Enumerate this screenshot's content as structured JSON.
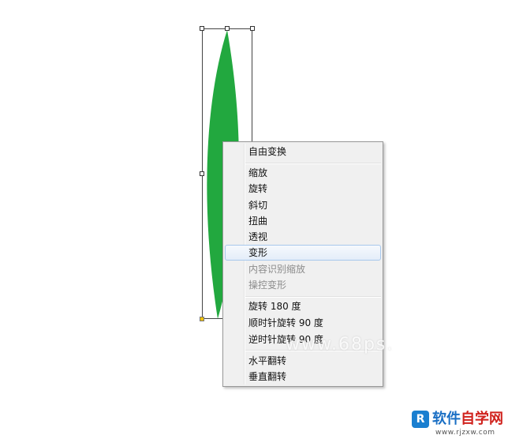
{
  "colors": {
    "leaf_fill": "#22a83f",
    "menu_background": "#f0f0f0",
    "menu_highlight_border": "#a8c8ec",
    "disabled_text": "#8c8c8c",
    "anchor_active": "#f0c000"
  },
  "context_menu": {
    "items": [
      {
        "label": "自由变换",
        "enabled": true
      },
      {
        "label": "缩放",
        "enabled": true
      },
      {
        "label": "旋转",
        "enabled": true
      },
      {
        "label": "斜切",
        "enabled": true
      },
      {
        "label": "扭曲",
        "enabled": true
      },
      {
        "label": "透视",
        "enabled": true
      },
      {
        "label": "变形",
        "enabled": true,
        "highlighted": true
      },
      {
        "label": "内容识别缩放",
        "enabled": false
      },
      {
        "label": "操控变形",
        "enabled": false
      },
      {
        "label": "旋转 180 度",
        "enabled": true
      },
      {
        "label": "顺时针旋转 90 度",
        "enabled": true
      },
      {
        "label": "逆时针旋转 90 度",
        "enabled": true
      },
      {
        "label": "水平翻转",
        "enabled": true
      },
      {
        "label": "垂直翻转",
        "enabled": true
      }
    ]
  },
  "watermark": {
    "text": "www.68ps."
  },
  "logo": {
    "mark": "R",
    "title_part1": "软件",
    "title_part2": "自学网",
    "url": "www.rjzxw.com"
  },
  "icons": {
    "transform_handle": "square-handle-icon",
    "leaf": "leaf-shape"
  }
}
